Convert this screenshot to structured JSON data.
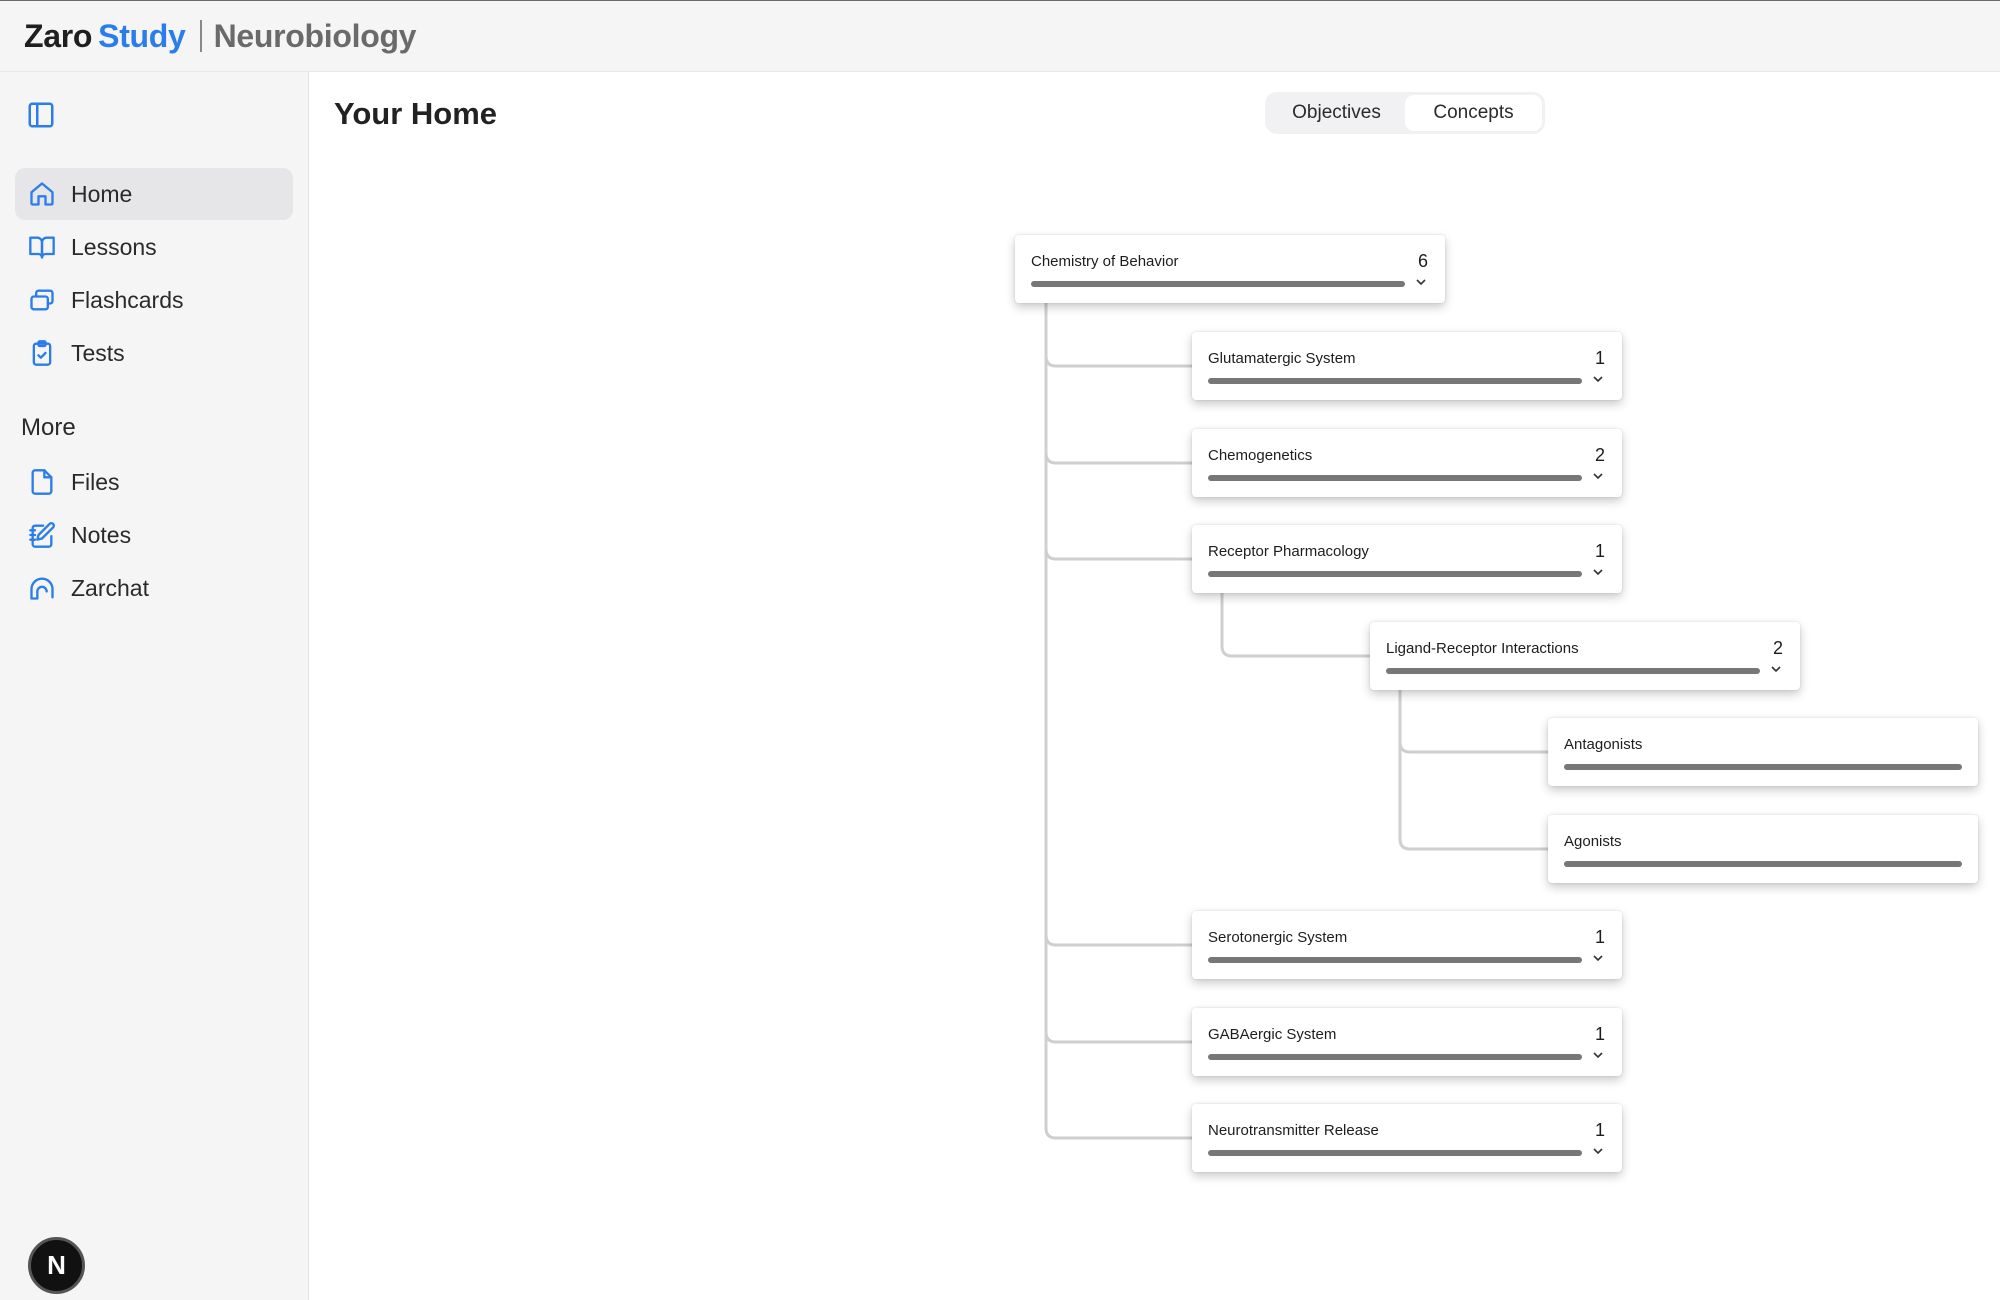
{
  "header": {
    "brand_part1": "Zaro",
    "brand_part2": "Study",
    "course": "Neurobiology"
  },
  "sidebar": {
    "toggle_icon": "sidebar-panel-icon",
    "items": [
      {
        "label": "Home",
        "icon": "home-icon",
        "active": true
      },
      {
        "label": "Lessons",
        "icon": "book-open-icon"
      },
      {
        "label": "Flashcards",
        "icon": "cards-icon"
      },
      {
        "label": "Tests",
        "icon": "clipboard-check-icon"
      }
    ],
    "more_heading": "More",
    "more_items": [
      {
        "label": "Files",
        "icon": "file-icon"
      },
      {
        "label": "Notes",
        "icon": "notebook-pen-icon"
      },
      {
        "label": "Zarchat",
        "icon": "chat-icon"
      }
    ],
    "avatar_letter": "N"
  },
  "main": {
    "title": "Your Home",
    "tabs": [
      {
        "label": "Objectives",
        "selected": false
      },
      {
        "label": "Concepts",
        "selected": true
      }
    ]
  },
  "concept_tree": {
    "root": {
      "title": "Chemistry of Behavior",
      "count": "6",
      "progress": 1.0
    },
    "children": [
      {
        "title": "Glutamatergic System",
        "count": "1",
        "progress": 1.0
      },
      {
        "title": "Chemogenetics",
        "count": "2",
        "progress": 1.0
      },
      {
        "title": "Receptor Pharmacology",
        "count": "1",
        "progress": 1.0,
        "children": [
          {
            "title": "Ligand-Receptor Interactions",
            "count": "2",
            "progress": 1.0,
            "children": [
              {
                "title": "Antagonists",
                "progress": 1.0
              },
              {
                "title": "Agonists",
                "progress": 1.0
              }
            ]
          }
        ]
      },
      {
        "title": "Serotonergic System",
        "count": "1",
        "progress": 1.0
      },
      {
        "title": "GABAergic System",
        "count": "1",
        "progress": 1.0
      },
      {
        "title": "Neurotransmitter Release",
        "count": "1",
        "progress": 1.0
      }
    ],
    "colors": {
      "bar": "#777777",
      "connector": "#cfcfd2"
    }
  },
  "colors": {
    "accent": "#2b7de9",
    "sidebar_bg": "#f5f5f6"
  }
}
